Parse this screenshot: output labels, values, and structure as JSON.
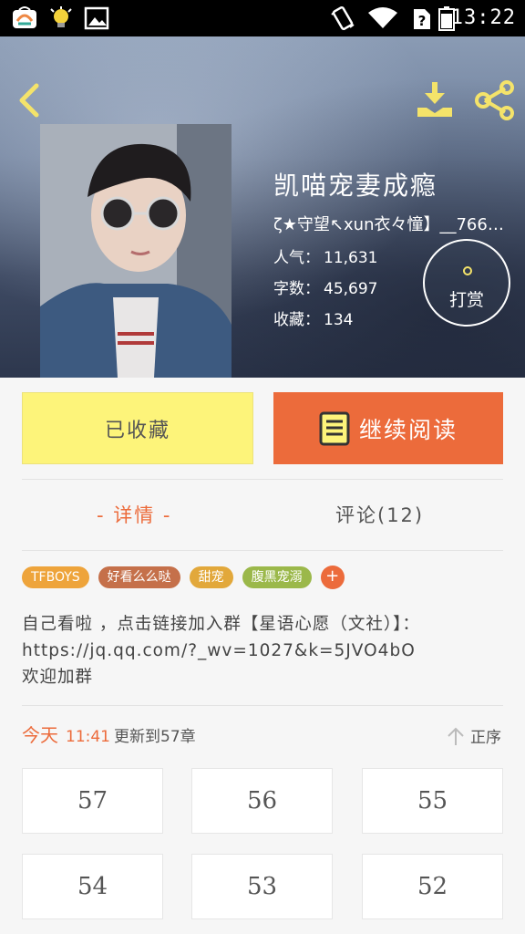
{
  "status_bar": {
    "time": "13:22",
    "icons": [
      "app-store-icon",
      "lightbulb-icon",
      "image-icon",
      "vibrate-icon",
      "wifi-icon",
      "no-sim-icon",
      "battery-icon"
    ]
  },
  "header": {
    "back_icon": "chevron-left-icon",
    "download_icon": "download-icon",
    "share_icon": "share-icon"
  },
  "book": {
    "title": "凯喵宠妻成瘾",
    "author": "ζ★守望↖xun衣々憧】__766…",
    "popularity_label": "人气：",
    "popularity": "11,631",
    "words_label": "字数：",
    "words": "45,697",
    "favorites_label": "收藏：",
    "favorites": "134",
    "reward_label": "打赏"
  },
  "actions": {
    "favorited_label": "已收藏",
    "continue_label": "继续阅读"
  },
  "tabs": {
    "detail_label": "- 详情 -",
    "comments_label": "评论(12)"
  },
  "tags": [
    {
      "label": "TFBOYS",
      "color": "#eea43b"
    },
    {
      "label": "好看么么哒",
      "color": "#c5704a"
    },
    {
      "label": "甜宠",
      "color": "#e2a83b"
    },
    {
      "label": "腹黑宠溺",
      "color": "#9bb84a"
    }
  ],
  "tag_add_label": "+",
  "description": "自己看啦 ，点击链接加入群【星语心愿（文社）】：https://jq.qq.com/?_wv=1027&k=5JVO4bO欢迎加群",
  "update": {
    "today": "今天",
    "time": "11:41",
    "info": "更新到57章",
    "order_label": "正序"
  },
  "chapters": [
    "57",
    "56",
    "55",
    "54",
    "53",
    "52"
  ],
  "colors": {
    "accent": "#ec6b3b",
    "favorite_button": "#fdf47a",
    "icon_yellow": "#f4e36a"
  }
}
